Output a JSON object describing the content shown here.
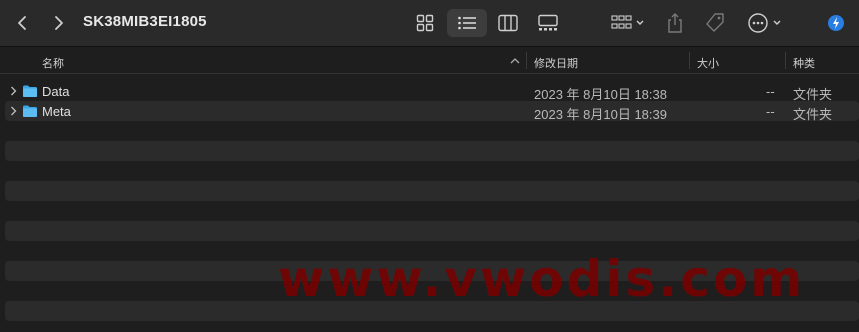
{
  "window": {
    "title": "SK38MIB3EI1805"
  },
  "toolbar": {
    "back_icon": "chevron-left-icon",
    "forward_icon": "chevron-right-icon",
    "views": [
      "icon-view-icon",
      "list-view-icon",
      "column-view-icon",
      "gallery-view-icon"
    ],
    "active_view": "list-view-icon",
    "group_icon": "group-by-icon",
    "share_icon": "share-icon",
    "tag_icon": "tag-icon",
    "more_icon": "more-actions-icon",
    "extension_icon": "extension-badge-icon"
  },
  "columns": {
    "name": "名称",
    "modified": "修改日期",
    "size": "大小",
    "kind": "种类"
  },
  "files": [
    {
      "name": "Data",
      "modified": "2023 年 8月10日 18:38",
      "size": "--",
      "kind": "文件夹"
    },
    {
      "name": "Meta",
      "modified": "2023 年 8月10日 18:39",
      "size": "--",
      "kind": "文件夹"
    }
  ],
  "watermark": "www.vwodis.com",
  "colors": {
    "folder": "#3aa6e8",
    "accent": "#2a7de1",
    "watermark": "#7a0000"
  }
}
